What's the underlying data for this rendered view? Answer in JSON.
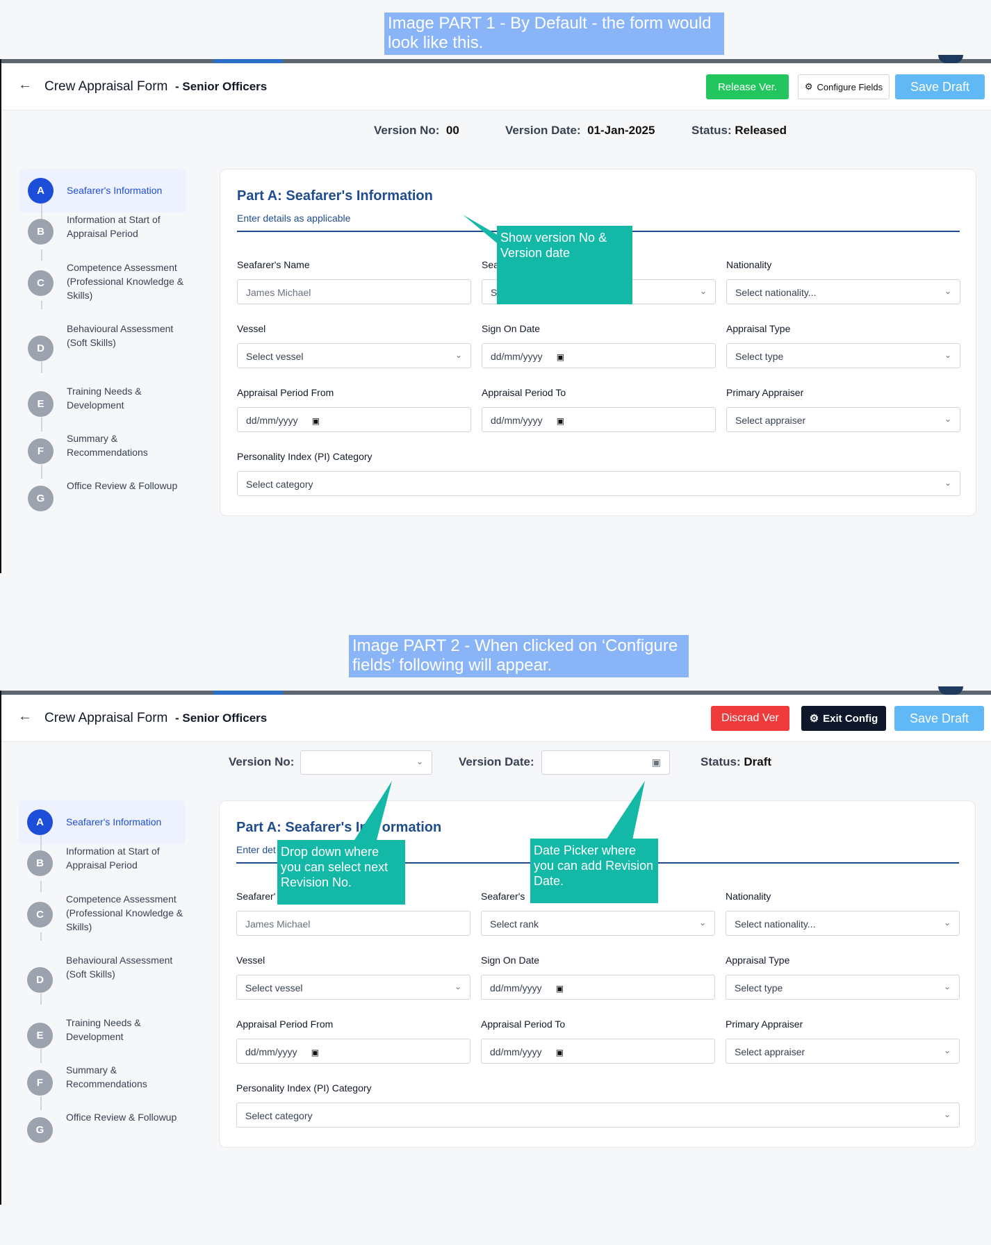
{
  "captions": {
    "part1": "Image PART 1 - By Default - the form would look like this.",
    "part2": "Image PART 2 - When clicked on ‘Configure fields’ following will appear."
  },
  "form": {
    "back_icon": "arrow-left-icon",
    "title": "Crew Appraisal Form",
    "subtitle": "- Senior Officers"
  },
  "part1": {
    "buttons": {
      "release": "Release Ver.",
      "configure": "Configure Fields",
      "save": "Save Draft"
    },
    "version": {
      "no_label": "Version No:",
      "no_value": "00",
      "date_label": "Version Date:",
      "date_value": "01-Jan-2025",
      "status_label": "Status:",
      "status_value": "Released"
    },
    "callout": "Show version No & Version date",
    "visible_fragments": {
      "rank_label": "Sea",
      "rank_value": "S"
    }
  },
  "part2": {
    "buttons": {
      "discard": "Discrad Ver",
      "exit": "Exit Config",
      "save": "Save Draft"
    },
    "version": {
      "no_label": "Version No:",
      "date_label": "Version Date:",
      "status_label": "Status:",
      "status_value": "Draft"
    },
    "callout_dropdown": "Drop down where you can select next Revision No.",
    "callout_date": "Date Picker where you can add Revision Date.",
    "visible_fragments": {
      "subtitle": "Enter det",
      "name_label": "Seafarer'",
      "title_left": "Part A: Seafarer's In",
      "title_right": "ormation",
      "rank_label": "Seafarer's"
    }
  },
  "steps": [
    {
      "letter": "A",
      "label": "Seafarer's Information"
    },
    {
      "letter": "B",
      "label": "Information at Start of Appraisal Period"
    },
    {
      "letter": "C",
      "label": "Competence Assessment (Professional Knowledge & Skills)"
    },
    {
      "letter": "D",
      "label": "Behavioural Assessment (Soft Skills)"
    },
    {
      "letter": "E",
      "label": "Training Needs & Development"
    },
    {
      "letter": "F",
      "label": "Summary & Recommendations"
    },
    {
      "letter": "G",
      "label": "Office Review & Followup"
    }
  ],
  "card": {
    "title": "Part A: Seafarer's Information",
    "subtitle": "Enter details as applicable",
    "fields": {
      "name": {
        "label": "Seafarer's Name",
        "value": "James Michael"
      },
      "rank": {
        "label": "Seafarer's",
        "value": "Select rank"
      },
      "nationality": {
        "label": "Nationality",
        "value": "Select nationality..."
      },
      "vessel": {
        "label": "Vessel",
        "value": "Select vessel"
      },
      "signon": {
        "label": "Sign On Date",
        "value": "dd/mm/yyyy"
      },
      "apptype": {
        "label": "Appraisal Type",
        "value": "Select type"
      },
      "from": {
        "label": "Appraisal Period From",
        "value": "dd/mm/yyyy"
      },
      "to": {
        "label": "Appraisal Period To",
        "value": "dd/mm/yyyy"
      },
      "appraiser": {
        "label": "Primary Appraiser",
        "value": "Select appraiser"
      },
      "pi": {
        "label": "Personality Index (PI) Category",
        "value": "Select category"
      }
    }
  },
  "icons": {
    "chevron": "chevron-down-icon",
    "calendar": "calendar-icon",
    "gear": "gear-icon"
  },
  "colors": {
    "accent": "#1d4ed8",
    "heading": "#1e4c8f",
    "callout": "#14b8a6",
    "caption": "#8ab4f8",
    "release": "#22c55e",
    "discard": "#ef3b3b",
    "save": "#60b8f5"
  }
}
